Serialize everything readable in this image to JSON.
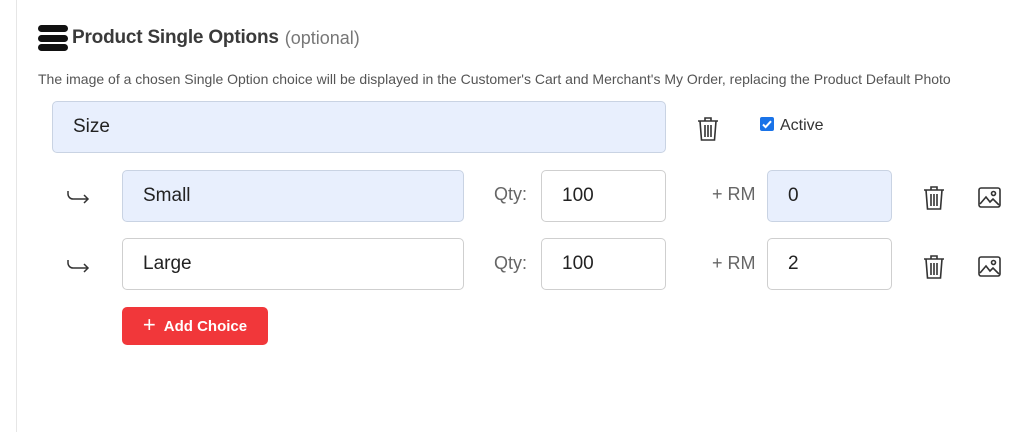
{
  "header": {
    "title": "Product Single Options",
    "optional": "(optional)",
    "icon": "stack-icon"
  },
  "description": "The image of a chosen Single Option choice will be displayed in the Customer's Cart and Merchant's My Order, replacing the Product Default Photo",
  "option": {
    "name": "Size",
    "active_label": "Active",
    "active_checked": true
  },
  "choices": [
    {
      "name": "Small",
      "qty_label": "Qty:",
      "qty": "100",
      "price_label": "+ RM",
      "price": "0"
    },
    {
      "name": "Large",
      "qty_label": "Qty:",
      "qty": "100",
      "price_label": "+ RM",
      "price": "2"
    }
  ],
  "add_choice_label": "Add Choice",
  "colors": {
    "accent_red": "#f1373a",
    "filled_field": "#e8effd",
    "checkbox_blue": "#1a73e8"
  }
}
